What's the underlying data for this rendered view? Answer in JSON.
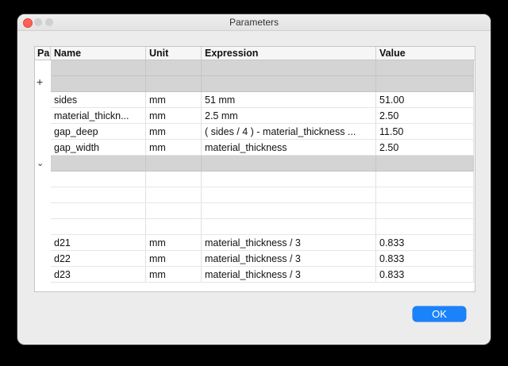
{
  "window": {
    "title": "Parameters"
  },
  "table": {
    "columns": [
      "Pa",
      "Name",
      "Unit",
      "Expression",
      "Value"
    ],
    "rows": [
      {
        "name": "sides",
        "unit": "mm",
        "expression": "51 mm",
        "value": "51.00"
      },
      {
        "name": "material_thickn...",
        "unit": "mm",
        "expression": "2.5 mm",
        "value": "2.50"
      },
      {
        "name": "gap_deep",
        "unit": "mm",
        "expression": "( sides / 4 ) - material_thickness ...",
        "value": "11.50"
      },
      {
        "name": "gap_width",
        "unit": "mm",
        "expression": "material_thickness",
        "value": "2.50"
      },
      {
        "name": "d21",
        "unit": "mm",
        "expression": "material_thickness / 3",
        "value": "0.833"
      },
      {
        "name": "d22",
        "unit": "mm",
        "expression": "material_thickness / 3",
        "value": "0.833"
      },
      {
        "name": "d23",
        "unit": "mm",
        "expression": "material_thickness / 3",
        "value": "0.833"
      }
    ],
    "icons": {
      "add": "plus-icon",
      "expand": "chevron-down-icon"
    }
  },
  "buttons": {
    "ok": "OK"
  },
  "colors": {
    "accent": "#1a82fb",
    "close": "#ff5f57",
    "group_row": "#d4d4d4"
  }
}
